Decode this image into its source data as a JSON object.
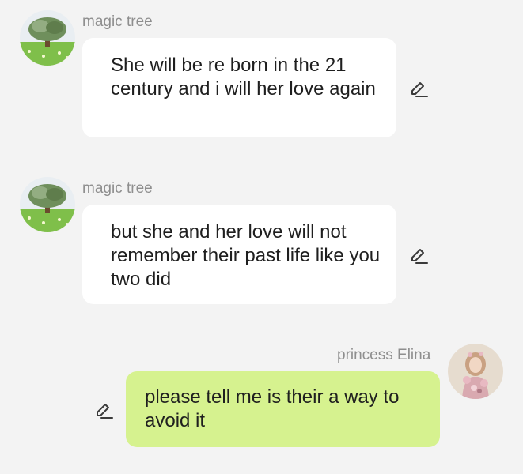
{
  "messages": [
    {
      "sender": "magic tree",
      "text": "She will be re born in the 21 century and i will her love again",
      "avatar_icon": "tree-avatar",
      "edit_icon": "edit-pencil-icon"
    },
    {
      "sender": "magic tree",
      "text": "but she and her love will not remember their past life like you two did",
      "avatar_icon": "tree-avatar",
      "edit_icon": "edit-pencil-icon"
    },
    {
      "sender": "princess Elina",
      "text": "please tell me is their a way to avoid it",
      "avatar_icon": "flower-girl-avatar",
      "edit_icon": "edit-pencil-icon"
    }
  ],
  "colors": {
    "background": "#f3f3f3",
    "incoming_bubble": "#ffffff",
    "outgoing_bubble": "#d6f28f",
    "sender_name": "#8e8e8e",
    "message_text": "#1f1f1f"
  }
}
